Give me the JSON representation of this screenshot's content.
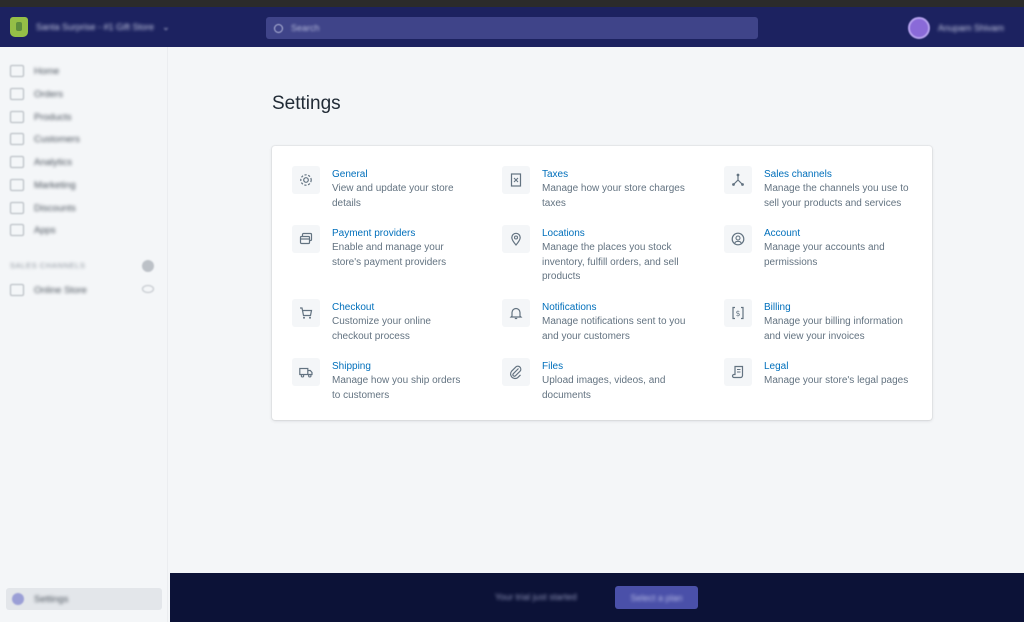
{
  "topbar": {
    "store_name": "Santa Surprise - #1 Gift Store",
    "search_placeholder": "Search",
    "user_name": "Anupam Shivam"
  },
  "sidebar": {
    "items": [
      {
        "label": "Home",
        "icon": "home-icon"
      },
      {
        "label": "Orders",
        "icon": "orders-icon"
      },
      {
        "label": "Products",
        "icon": "tag-icon"
      },
      {
        "label": "Customers",
        "icon": "customers-icon"
      },
      {
        "label": "Analytics",
        "icon": "analytics-icon"
      },
      {
        "label": "Marketing",
        "icon": "marketing-icon"
      },
      {
        "label": "Discounts",
        "icon": "discount-icon"
      },
      {
        "label": "Apps",
        "icon": "apps-icon"
      }
    ],
    "section_title": "SALES CHANNELS",
    "channel": {
      "label": "Online Store",
      "icon": "store-icon"
    },
    "settings_label": "Settings"
  },
  "main": {
    "title": "Settings",
    "tiles": [
      {
        "title": "General",
        "desc": [
          "View and update your store",
          "details"
        ],
        "icon": "gear-icon"
      },
      {
        "title": "Taxes",
        "desc": [
          "Manage how your store charges",
          "taxes"
        ],
        "icon": "receipt-icon"
      },
      {
        "title": "Sales channels",
        "desc": [
          "Manage the channels you use to",
          "sell your products and services"
        ],
        "icon": "channels-icon"
      },
      {
        "title": "Payment providers",
        "desc": [
          "Enable and manage your",
          "store's payment providers"
        ],
        "icon": "payment-icon"
      },
      {
        "title": "Locations",
        "desc": [
          "Manage the places you stock",
          "inventory, fulfill orders, and sell",
          "products"
        ],
        "icon": "location-pin-icon"
      },
      {
        "title": "Account",
        "desc": [
          "Manage your accounts and",
          "permissions"
        ],
        "icon": "account-icon"
      },
      {
        "title": "Checkout",
        "desc": [
          "Customize your online",
          "checkout process"
        ],
        "icon": "cart-icon"
      },
      {
        "title": "Notifications",
        "desc": [
          "Manage notifications sent to you",
          "and your customers"
        ],
        "icon": "bell-icon"
      },
      {
        "title": "Billing",
        "desc": [
          "Manage your billing information",
          "and view your invoices"
        ],
        "icon": "billing-icon"
      },
      {
        "title": "Shipping",
        "desc": [
          "Manage how you ship orders",
          "to customers"
        ],
        "icon": "truck-icon"
      },
      {
        "title": "Files",
        "desc": [
          "Upload images, videos, and",
          "documents"
        ],
        "icon": "paperclip-icon"
      },
      {
        "title": "Legal",
        "desc": [
          "Manage your store's legal pages"
        ],
        "icon": "legal-scroll-icon"
      }
    ]
  },
  "footer": {
    "text": "Your trial just started",
    "button_label": "Select a plan"
  },
  "colors": {
    "topbar": "#1c2260",
    "footer": "#0c1237",
    "link": "#006fbb",
    "description": "#637381"
  }
}
